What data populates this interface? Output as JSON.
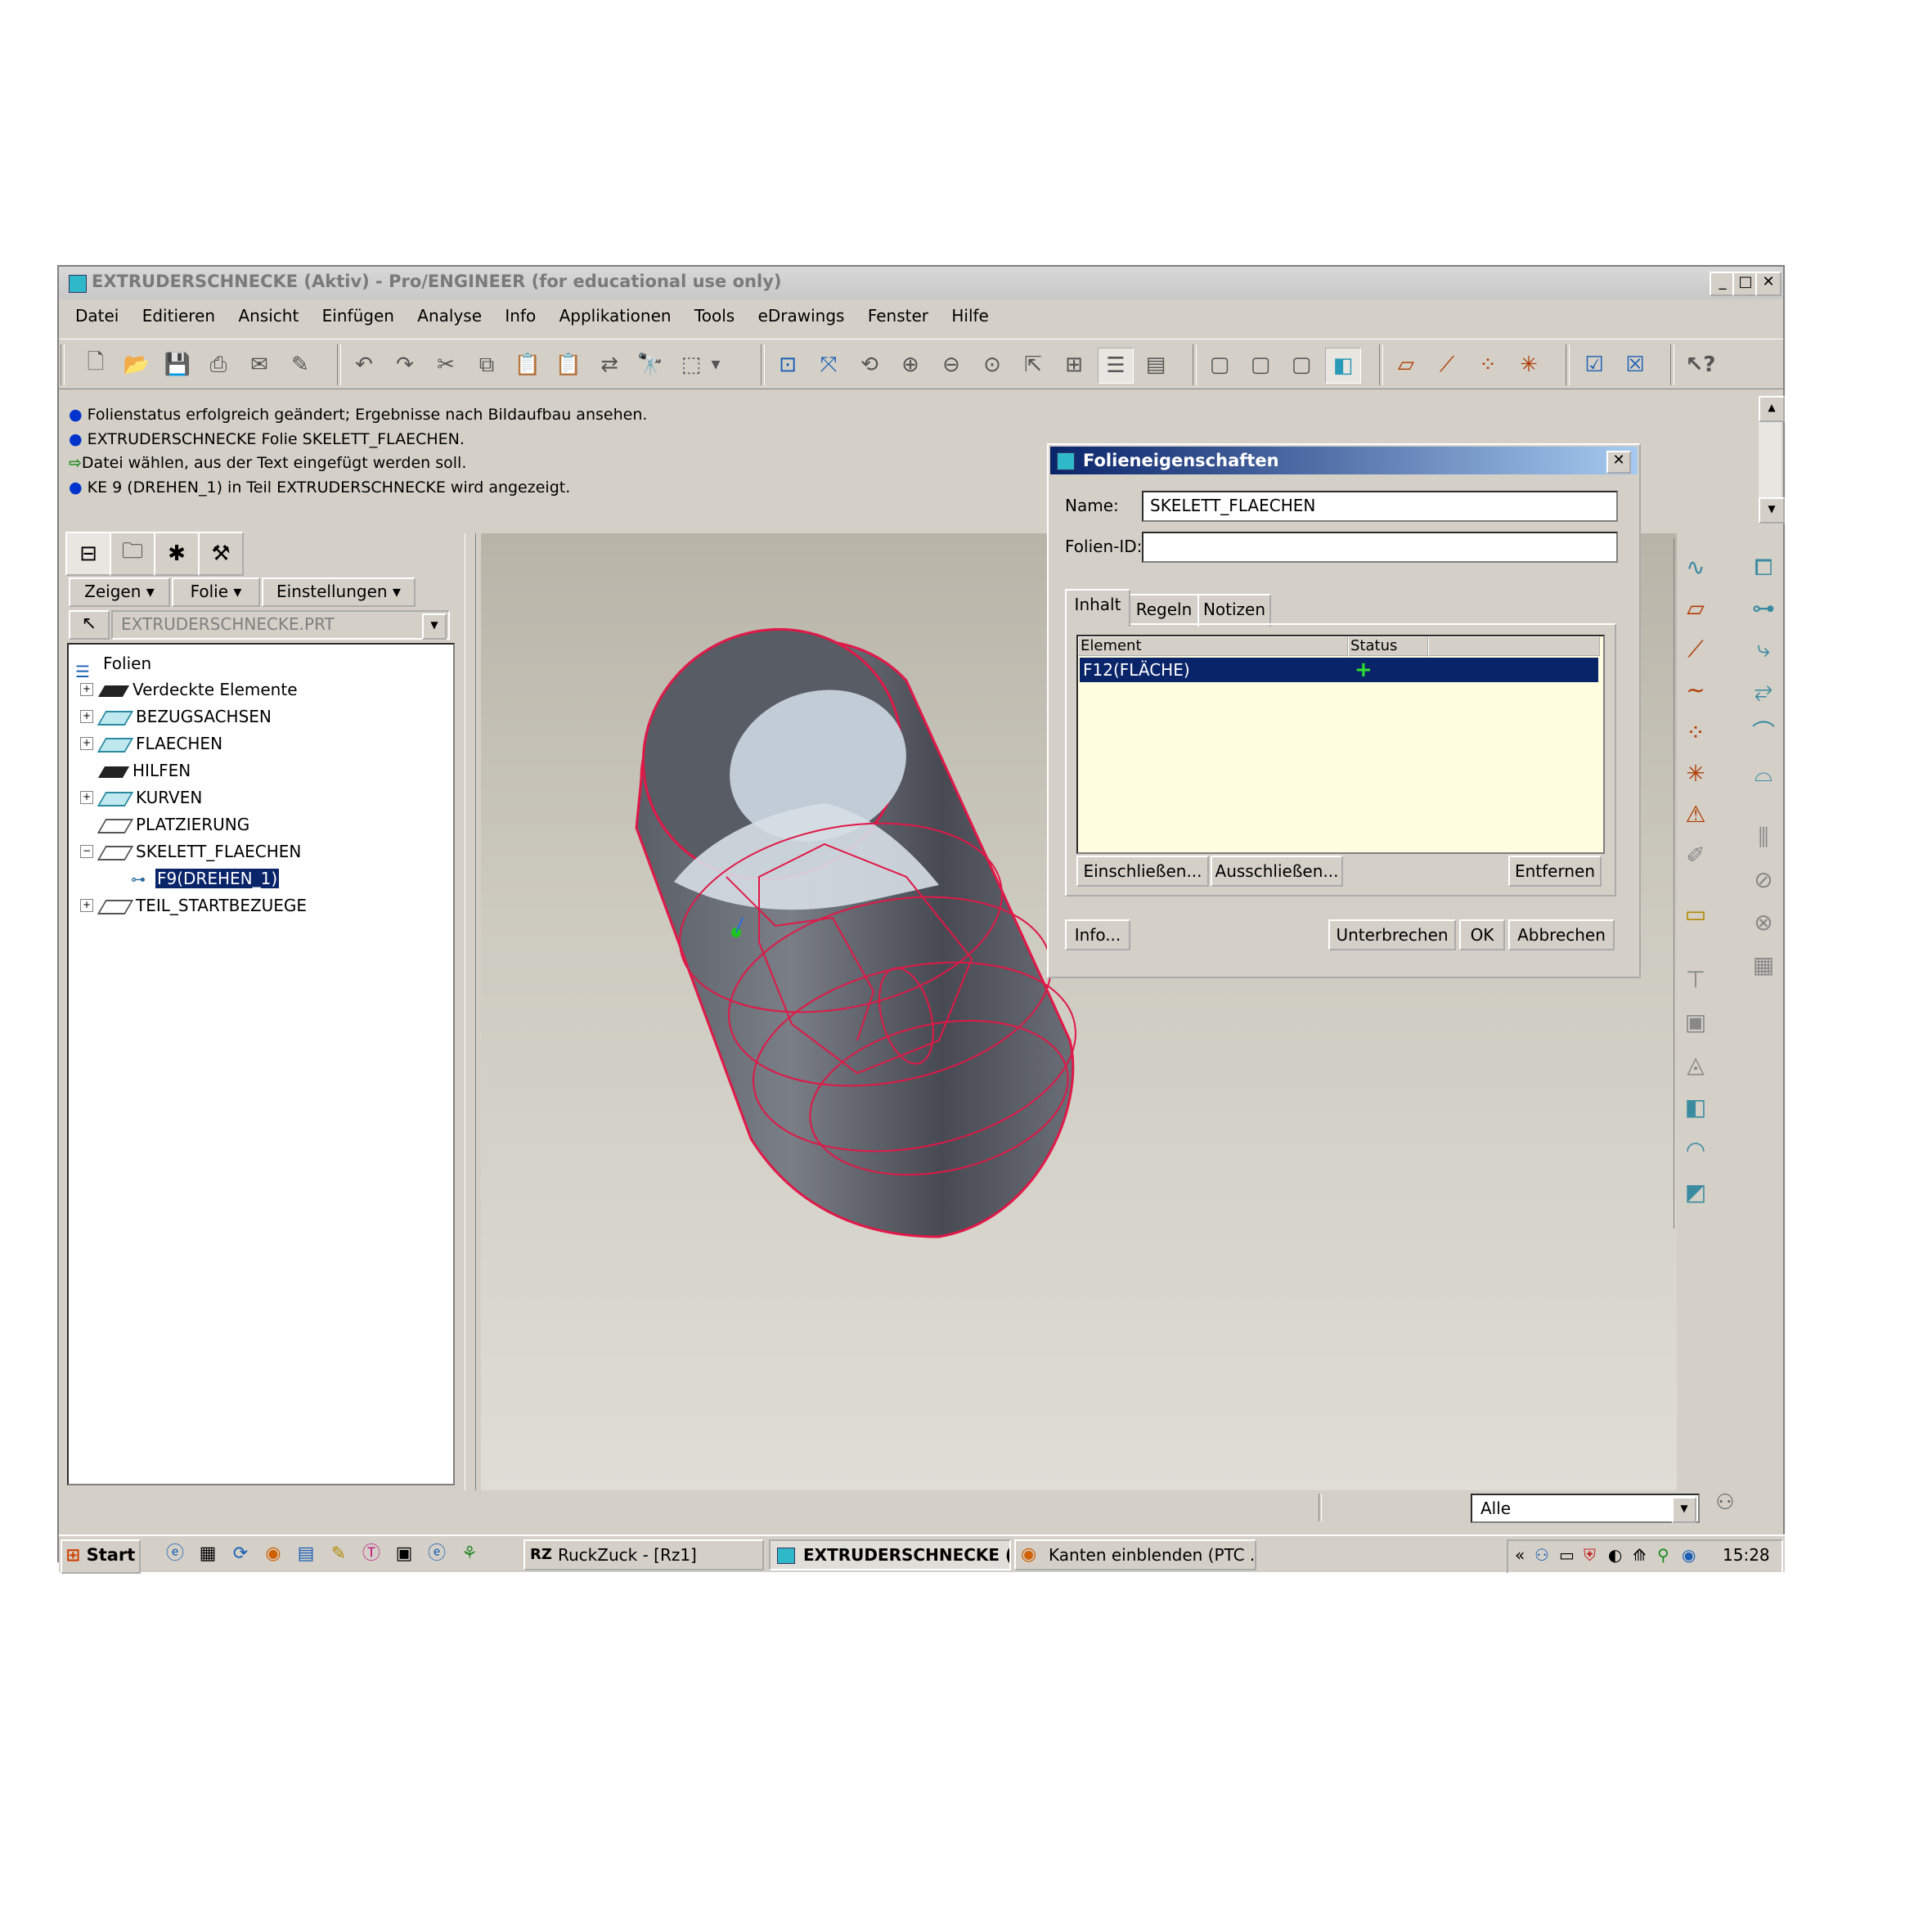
{
  "window": {
    "title": "EXTRUDERSCHNECKE (Aktiv) - Pro/ENGINEER (for educational use only)"
  },
  "menu": [
    "Datei",
    "Editieren",
    "Ansicht",
    "Einfügen",
    "Analyse",
    "Info",
    "Applikationen",
    "Tools",
    "eDrawings",
    "Fenster",
    "Hilfe"
  ],
  "messages": {
    "m1": "Folienstatus erfolgreich geändert; Ergebnisse nach Bildaufbau ansehen.",
    "m2": "EXTRUDERSCHNECKE Folie SKELETT_FLAECHEN.",
    "m3": "Datei wählen, aus der Text eingefügt werden soll.",
    "m4": "KE 9 (DREHEN_1) in Teil EXTRUDERSCHNECKE wird angezeigt."
  },
  "navigator": {
    "buttons": {
      "zeigen": "Zeigen",
      "folie": "Folie",
      "einstellungen": "Einstellungen"
    },
    "model_combo": "EXTRUDERSCHNECKE.PRT",
    "tree": {
      "root": "Folien",
      "items": [
        "Verdeckte Elemente",
        "BEZUGSACHSEN",
        "FLAECHEN",
        "HILFEN",
        "KURVEN",
        "PLATZIERUNG",
        "SKELETT_FLAECHEN",
        "F9(DREHEN_1)",
        "TEIL_STARTBEZUEGE"
      ]
    }
  },
  "dialog": {
    "title": "Folieneigenschaften",
    "name_label": "Name:",
    "name_value": "SKELETT_FLAECHEN",
    "id_label": "Folien-ID:",
    "id_value": "",
    "tabs": [
      "Inhalt",
      "Regeln",
      "Notizen"
    ],
    "columns": [
      "Element",
      "Status"
    ],
    "rows": [
      {
        "element": "F12(FLÄCHE)",
        "status": "+"
      }
    ],
    "buttons": {
      "include": "Einschließen...",
      "exclude": "Ausschließen...",
      "remove": "Entfernen",
      "info": "Info...",
      "interrupt": "Unterbrechen",
      "ok": "OK",
      "cancel": "Abbrechen"
    }
  },
  "statusbar": {
    "filter": "Alle"
  },
  "taskbar": {
    "start": "Start",
    "tasks": [
      "RuckZuck - [Rz1]",
      "EXTRUDERSCHNECKE (...",
      "Kanten einblenden (PTC ..."
    ],
    "task_icon_rz": "RZ",
    "clock": "15:28",
    "tray_chevron": "«"
  }
}
